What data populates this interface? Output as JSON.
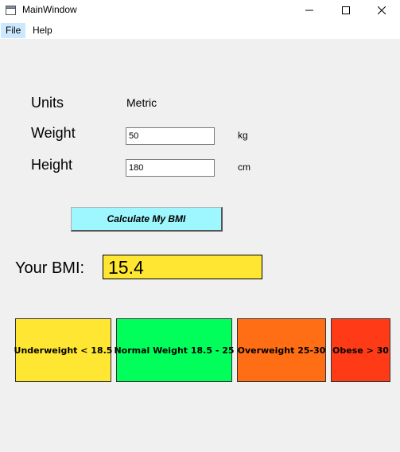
{
  "window": {
    "title": "MainWindow"
  },
  "menu": {
    "file": "File",
    "help": "Help"
  },
  "form": {
    "units_label": "Units",
    "units_value": "Metric",
    "weight_label": "Weight",
    "weight_value": "50",
    "weight_unit": "kg",
    "height_label": "Height",
    "height_value": "180",
    "height_unit": "cm"
  },
  "calculate_button": "Calculate My BMI",
  "result": {
    "label": "Your BMI:",
    "value": "15.4"
  },
  "categories": [
    {
      "label": "Underweight < 18.5",
      "color": "#ffe633"
    },
    {
      "label": "Normal Weight 18.5 - 25",
      "color": "#00ff5a"
    },
    {
      "label": "Overweight 25-30",
      "color": "#ff6d15"
    },
    {
      "label": "Obese > 30",
      "color": "#ff3b17"
    }
  ],
  "colors": {
    "calculate_button_bg": "#9ef6ff",
    "bmi_value_bg": "#ffe633"
  }
}
